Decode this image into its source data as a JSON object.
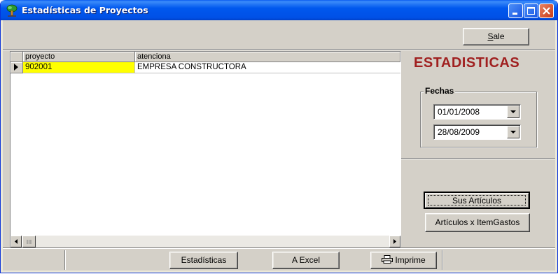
{
  "window": {
    "title": "Estadísticas de Proyectos",
    "icon": "tree-app-icon"
  },
  "toolbar": {
    "sale_label_prefix": "S",
    "sale_label_rest": "ale"
  },
  "grid": {
    "columns": [
      "proyecto",
      "atenciona"
    ],
    "rows": [
      {
        "proyecto": "902001",
        "atenciona": "EMPRESA CONSTRUCTORA"
      }
    ]
  },
  "panel": {
    "heading": "ESTADISTICAS",
    "fechas_label": "Fechas",
    "fecha_desde": "01/01/2008",
    "fecha_hasta": "28/08/2009",
    "sus_articulos_label": "Sus Artículos",
    "articulos_itemgastos_label": "Artículos x ItemGastos"
  },
  "bottom": {
    "estadisticas_label": "Estadísticas",
    "excel_label": "A Excel",
    "imprime_label": "Imprime"
  },
  "colors": {
    "heading": "#a02020",
    "selected_cell": "#ffff00",
    "titlebar": "#0058ee"
  }
}
